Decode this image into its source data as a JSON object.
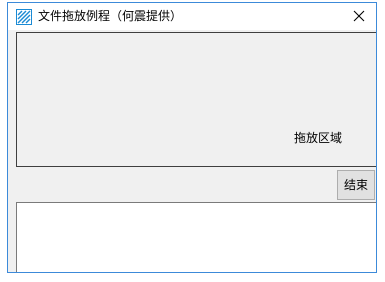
{
  "window": {
    "title": "文件拖放例程（何震提供）",
    "app_icon": "striped-app-icon",
    "close_icon": "close-icon",
    "accent_color": "#3c8ad9"
  },
  "drop_area": {
    "label": "拖放区域"
  },
  "buttons": {
    "end_label": "结束"
  },
  "output": {
    "value": ""
  }
}
